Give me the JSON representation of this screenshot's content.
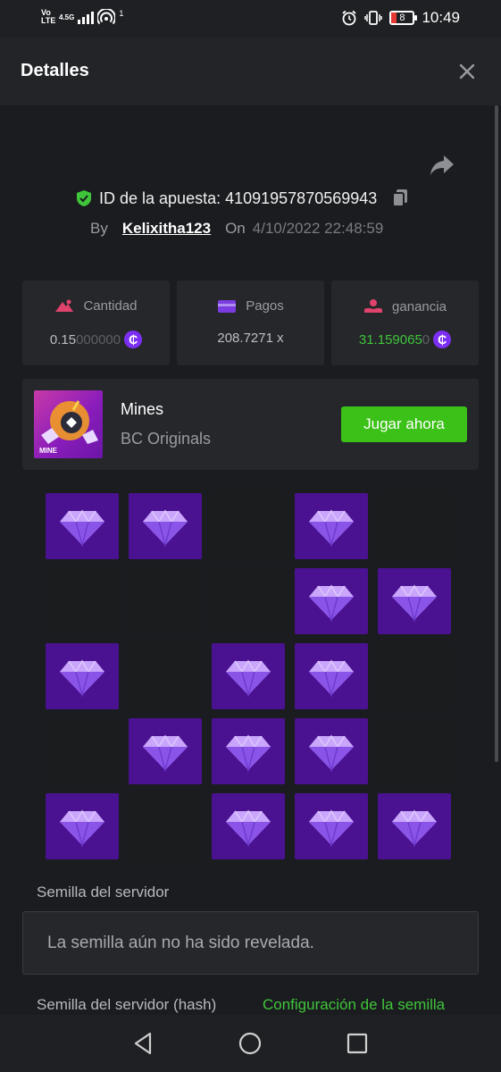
{
  "status_bar": {
    "network_top": "Vo",
    "network_bottom": "LTE",
    "net_type": "4.5G",
    "hotspot_count": "1",
    "battery": "8",
    "time": "10:49"
  },
  "header": {
    "title": "Detalles"
  },
  "bet": {
    "id_label": "ID de la apuesta: 41091957870569943",
    "by_label": "By",
    "user": "Kelixitha123",
    "on_label": "On",
    "date": "4/10/2022 22:48:59"
  },
  "stats": {
    "amount_label": "Cantidad",
    "amount_main": "0.15",
    "amount_dim": "000000",
    "payout_label": "Pagos",
    "payout_value": "208.7271 x",
    "profit_label": "ganancia",
    "profit_main": "31.159065",
    "profit_dim": "0",
    "coin_symbol": "₵"
  },
  "game": {
    "name": "Mines",
    "provider": "BC Originals",
    "play_button": "Jugar ahora",
    "thumb_label": "MINE"
  },
  "board": {
    "rows": [
      [
        "gem",
        "gem",
        "empty",
        "gem",
        "empty"
      ],
      [
        "empty",
        "empty",
        "empty",
        "gem",
        "gem"
      ],
      [
        "gem",
        "empty",
        "gem",
        "gem",
        "empty"
      ],
      [
        "empty",
        "gem",
        "gem",
        "gem",
        "empty"
      ],
      [
        "gem",
        "empty",
        "gem",
        "gem",
        "gem"
      ]
    ]
  },
  "seeds": {
    "server_seed_label": "Semilla del servidor",
    "server_seed_value": "La semilla aún no ha sido revelada.",
    "server_hash_label": "Semilla del servidor (hash)",
    "seed_config_link": "Configuración de la semilla"
  },
  "colors": {
    "accent_green": "#3bc117",
    "gem_tile": "#4a1290",
    "coin": "#7b2ff2"
  }
}
